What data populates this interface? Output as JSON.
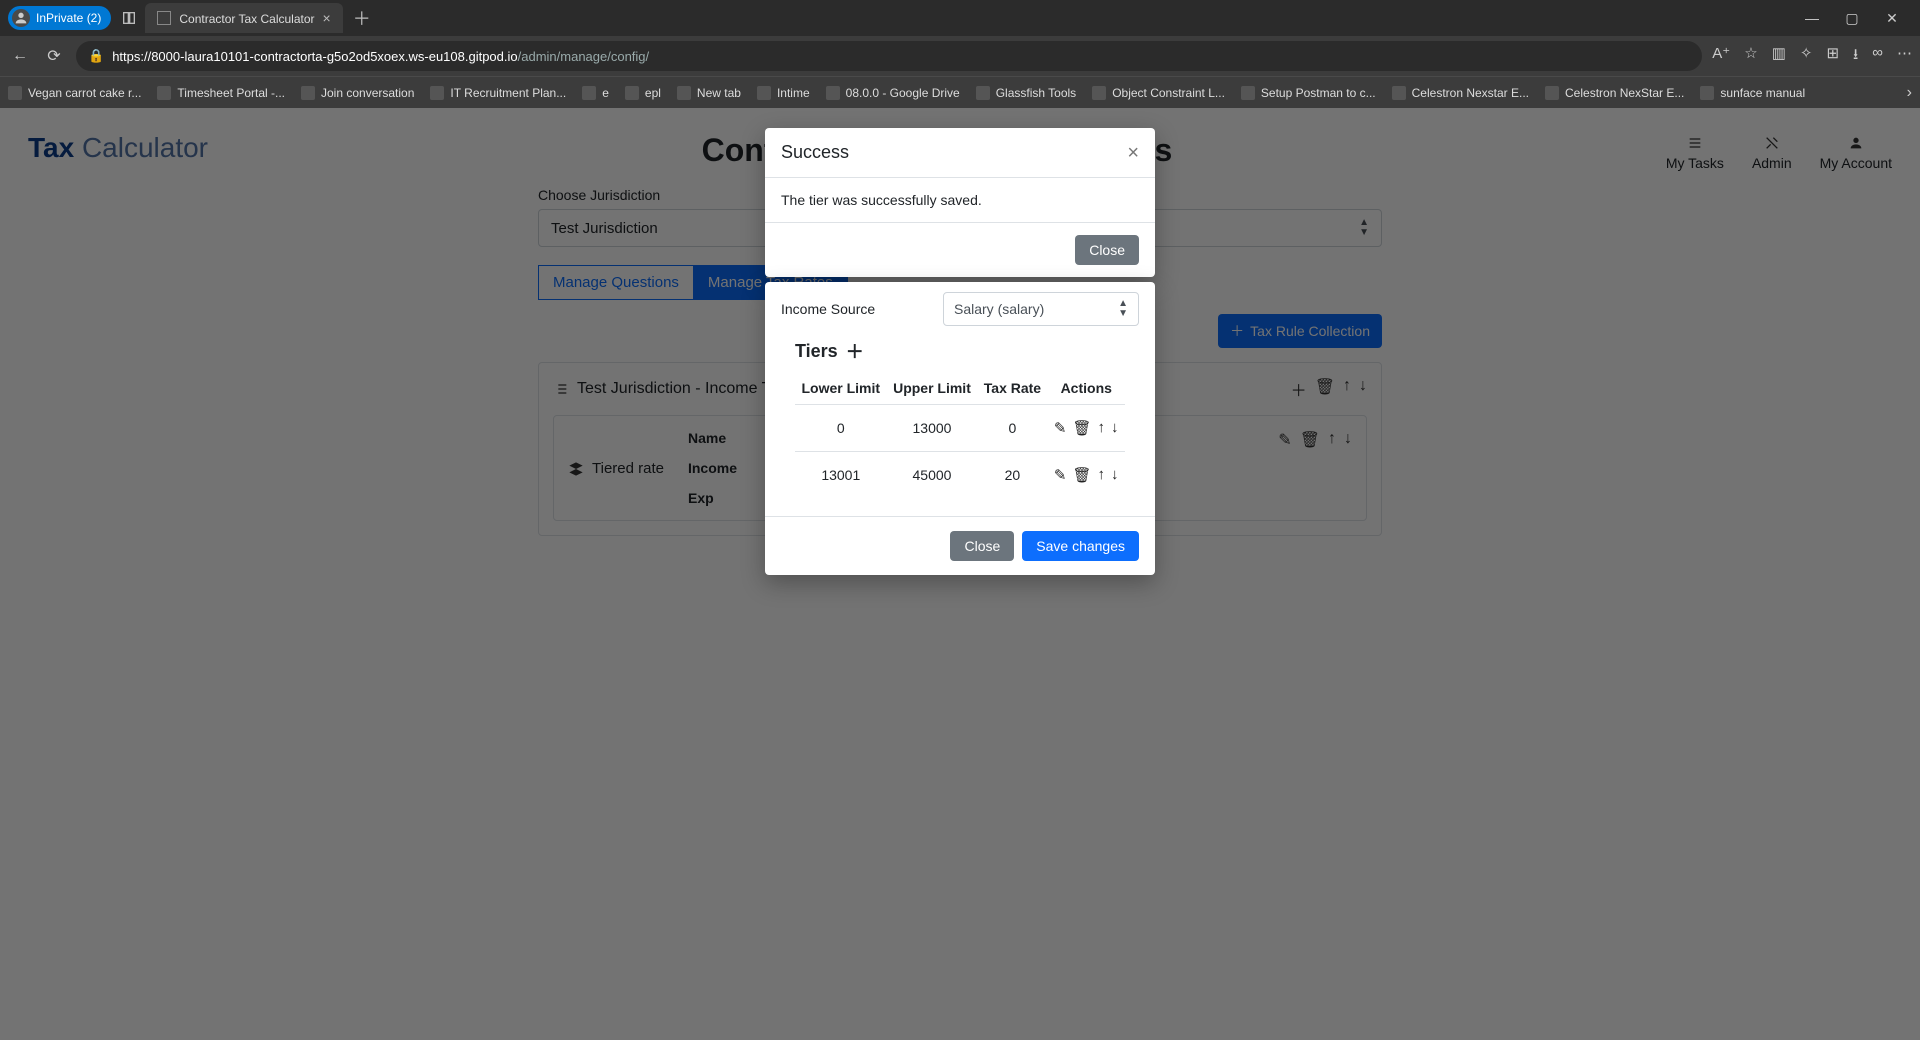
{
  "browser": {
    "inprivate_label": "InPrivate (2)",
    "tab_title": "Contractor Tax Calculator",
    "url_host": "https://8000-laura10101-contractorta-g5o2od5xoex.ws-eu108.gitpod.io",
    "url_path": "/admin/manage/config/",
    "bookmarks": [
      "Vegan carrot cake r...",
      "Timesheet Portal -...",
      "Join conversation",
      "IT Recruitment Plan...",
      "e",
      "epl",
      "New tab",
      "Intime",
      "08.0.0 - Google Drive",
      "Glassfish Tools",
      "Object Constraint L...",
      "Setup Postman to c...",
      "Celestron Nexstar E...",
      "Celestron NexStar E...",
      "sunface manual"
    ]
  },
  "page": {
    "brand_bold": "Tax",
    "brand_rest": " Calculator",
    "title": "Configure Tax Rules and Rates",
    "nav_my_tasks": "My Tasks",
    "nav_admin": "Admin",
    "nav_account": "My Account",
    "choose_label": "Choose Jurisdiction",
    "jurisdiction_value": "Test Jurisdiction",
    "tab_questions": "Manage Questions",
    "tab_rates": "Manage Tax Rates",
    "btn_rule_collection": "Tax Rule Collection",
    "panel_title": "Test Jurisdiction - Income Tax",
    "tiered_label": "Tiered rate",
    "col_name": "Name",
    "col_income": "Income",
    "col_exp": "Exp"
  },
  "success": {
    "title": "Success",
    "body": "The tier was successfully saved.",
    "close": "Close"
  },
  "tiers": {
    "income_source_label": "Income Source",
    "income_source_value": "Salary (salary)",
    "tiers_title": "Tiers",
    "headers": {
      "lower": "Lower Limit",
      "upper": "Upper Limit",
      "rate": "Tax Rate",
      "actions": "Actions"
    },
    "rows": [
      {
        "lower": "0",
        "upper": "13000",
        "rate": "0"
      },
      {
        "lower": "13001",
        "upper": "45000",
        "rate": "20"
      }
    ],
    "close": "Close",
    "save": "Save changes"
  }
}
